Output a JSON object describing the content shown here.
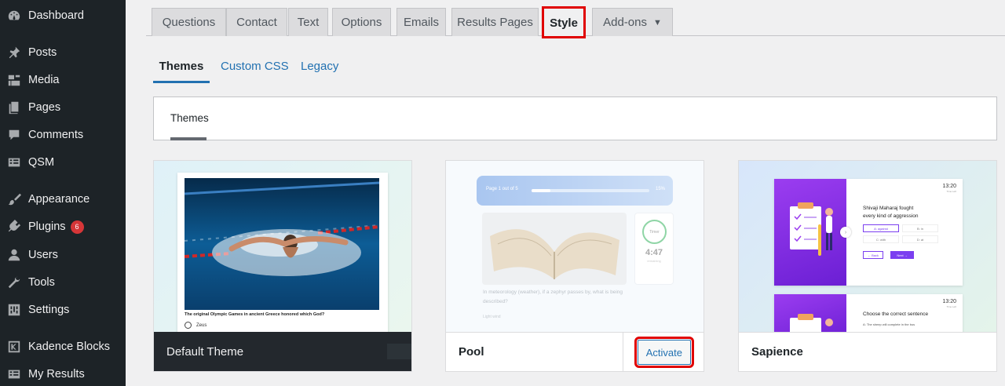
{
  "sidebar": {
    "items": [
      {
        "label": "Dashboard",
        "icon": "dashboard-icon"
      },
      {
        "label": "Posts",
        "icon": "pin-icon"
      },
      {
        "label": "Media",
        "icon": "media-icon"
      },
      {
        "label": "Pages",
        "icon": "pages-icon"
      },
      {
        "label": "Comments",
        "icon": "comments-icon"
      },
      {
        "label": "QSM",
        "icon": "qsm-icon"
      },
      {
        "label": "Appearance",
        "icon": "brush-icon"
      },
      {
        "label": "Plugins",
        "icon": "plugin-icon",
        "badge": "6"
      },
      {
        "label": "Users",
        "icon": "users-icon"
      },
      {
        "label": "Tools",
        "icon": "wrench-icon"
      },
      {
        "label": "Settings",
        "icon": "settings-icon"
      },
      {
        "label": "Kadence Blocks",
        "icon": "kadence-icon"
      },
      {
        "label": "My Results",
        "icon": "results-icon"
      }
    ]
  },
  "tabs": [
    "Questions",
    "Contact",
    "Text",
    "Options",
    "Emails",
    "Results Pages",
    "Style",
    "Add-ons"
  ],
  "active_tab": "Style",
  "subtabs": [
    "Themes",
    "Custom CSS",
    "Legacy"
  ],
  "panel": {
    "label": "Themes"
  },
  "themes": [
    {
      "name": "Default Theme",
      "question": "The original Olympic Games in ancient Greece honored which God?",
      "answer": "Zeus"
    },
    {
      "name": "Pool",
      "action": "Activate",
      "progress": "Page 1 out of 5",
      "percent": "15%",
      "timer_label": "Timer",
      "timer_value": "4:47",
      "timer_sub": "remaining",
      "question": "In meteorology (weather), if a zephyr passes by, what is being described?",
      "option": "Light wind"
    },
    {
      "name": "Sapience",
      "time": "13:20",
      "time_sub": "Time Left",
      "q1_line1": "Shivaji Maharaj fought",
      "q1_line2": "every kind of aggression",
      "opt_a": "A: against",
      "opt_b": "B: in",
      "opt_c": "C: with",
      "opt_d": "D: at",
      "back": "← Back",
      "next": "Next →",
      "q2": "Choose the correct sentence",
      "q2_opt": "A: The sheep will complete in the bus"
    }
  ],
  "colors": {
    "highlight": "#e00000",
    "accent": "#2271b1",
    "sidebar": "#1d2327",
    "purple": "#8a2be2"
  }
}
